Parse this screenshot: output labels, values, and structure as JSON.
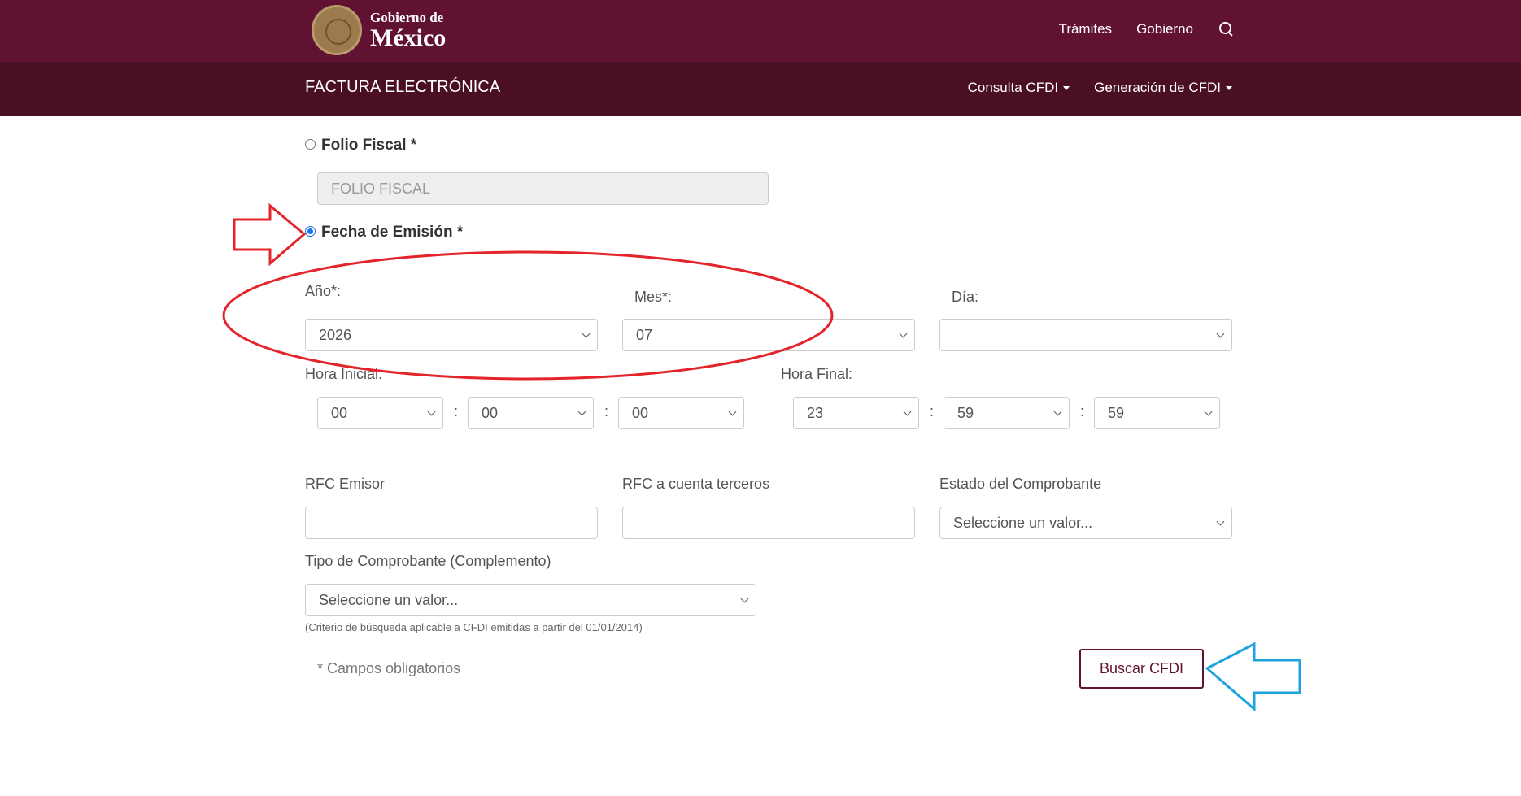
{
  "header": {
    "logo_small": "Gobierno de",
    "logo_big": "México",
    "nav": [
      "Trámites",
      "Gobierno"
    ]
  },
  "subheader": {
    "title": "FACTURA ELECTRÓNICA",
    "menus": [
      "Consulta CFDI",
      "Generación de CFDI"
    ]
  },
  "form": {
    "folio_radio_label": "Folio Fiscal *",
    "folio_placeholder": "FOLIO FISCAL",
    "fecha_radio_label": "Fecha de Emisión *",
    "anio_label": "Año*:",
    "anio_value": "2026",
    "mes_label": "Mes*:",
    "mes_value": "07",
    "dia_label": "Día:",
    "dia_value": "",
    "hora_inicial_label": "Hora Inicial:",
    "hora_inicial": [
      "00",
      "00",
      "00"
    ],
    "hora_final_label": "Hora Final:",
    "hora_final": [
      "23",
      "59",
      "59"
    ],
    "colon": ":",
    "rfc_emisor_label": "RFC Emisor",
    "rfc_terceros_label": "RFC a cuenta terceros",
    "estado_label": "Estado del Comprobante",
    "estado_value": "Seleccione un valor...",
    "tipo_label": "Tipo de Comprobante (Complemento)",
    "tipo_value": "Seleccione un valor...",
    "criterio_note": "(Criterio de búsqueda aplicable a CFDI emitidas a partir del 01/01/2014)",
    "required_note": "* Campos obligatorios",
    "buscar_button": "Buscar CFDI"
  },
  "colors": {
    "brand_primary": "#611232",
    "brand_dark": "#4a0e25",
    "annotation_red": "#e3242b",
    "annotation_blue": "#1fa3e0"
  },
  "icons": [
    "search-icon",
    "chevron-down-icon",
    "red-arrow-annotation",
    "blue-arrow-annotation"
  ]
}
